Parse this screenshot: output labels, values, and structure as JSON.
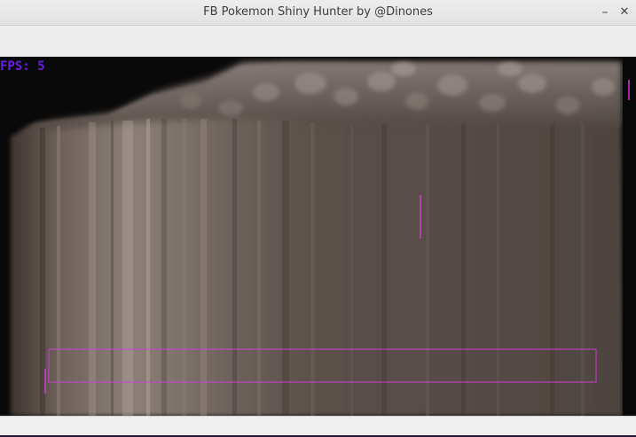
{
  "window": {
    "title": "FB Pokemon Shiny Hunter by @Dinones"
  },
  "controls": {
    "minimize_glyph": "–",
    "close_glyph": "✕"
  },
  "viewport": {
    "fps_label": "FPS: 5",
    "overlay_color": "#d23cd6",
    "fps_color": "#6a1ee0"
  }
}
